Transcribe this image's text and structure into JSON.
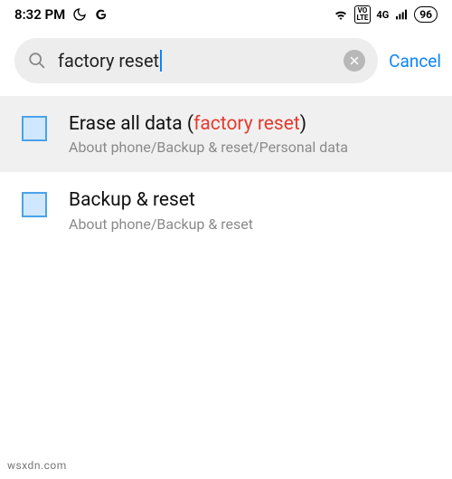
{
  "status": {
    "time": "8:32 PM",
    "network_label": "4G",
    "lte_label": "LTE",
    "vo_label": "VO",
    "battery": "96"
  },
  "search": {
    "query": "factory reset",
    "cancel_label": "Cancel"
  },
  "results": [
    {
      "title_pre": "Erase all data (",
      "title_match": "factory reset",
      "title_post": ")",
      "path": "About phone/Backup & reset/Personal data",
      "highlighted": true
    },
    {
      "title_pre": "Backup & reset",
      "title_match": "",
      "title_post": "",
      "path": "About phone/Backup & reset",
      "highlighted": false
    }
  ],
  "watermark": "wsxdn.com"
}
